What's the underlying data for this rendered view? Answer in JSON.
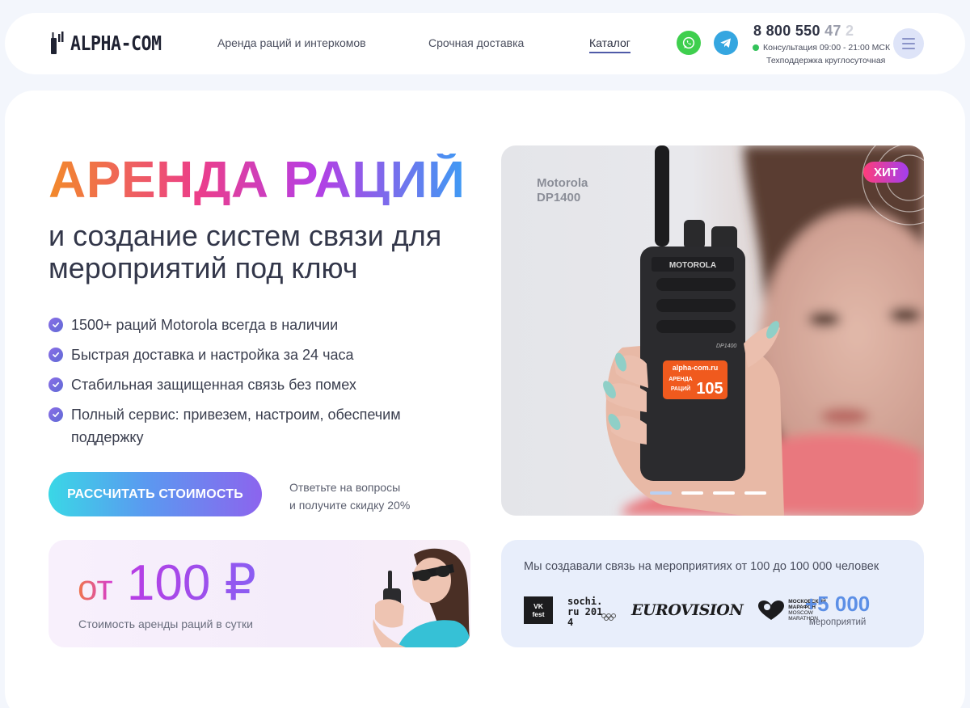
{
  "header": {
    "logo_text": "ALPHA-COM",
    "nav": {
      "rental": "Аренда раций и интеркомов",
      "delivery": "Срочная доставка",
      "catalog": "Каталог"
    },
    "phone": {
      "main": "8 800 550 ",
      "mid": "47",
      "tail": " 2"
    },
    "consult": "Консультация 09:00 - 21:00 МСК",
    "support": "Техподдержка круглосуточная"
  },
  "hero": {
    "title": "АРЕНДА РАЦИЙ",
    "subtitle": "и создание систем связи для мероприятий под ключ",
    "features": [
      "1500+ раций Motorola всегда в наличии",
      "Быстрая доставка и настройка за 24 часа",
      "Стабильная защищенная связь без помех",
      "Полный сервис: привезем, настроим, обеспечим поддержку"
    ],
    "cta_label": "РАССЧИТАТЬ СТОИМОСТЬ",
    "cta_note_line1": "Ответьте на вопросы",
    "cta_note_line2": "и получите скидку 20%"
  },
  "product": {
    "model_line1": "Motorola",
    "model_line2": "DP1400",
    "badge": "ХИТ",
    "radio_brand": "MOTOROLA",
    "radio_model": "DP1400",
    "sticker_site": "alpha-com.ru",
    "sticker_line1": "АРЕНДА",
    "sticker_line2": "РАЦИЙ",
    "sticker_number": "105"
  },
  "price": {
    "prefix": "от",
    "value": "100 ₽",
    "caption": "Стоимость аренды раций в сутки"
  },
  "events": {
    "title": "Мы создавали связь на мероприятиях от 100 до 100 000 человек",
    "logos": {
      "vk_fest": "VK fest",
      "sochi": "sochi.ru 2014",
      "eurovision": "EUROVISION",
      "marathon_l1": "МОСКОВСКИЙ",
      "marathon_l2": "МАРАФОН",
      "marathon_l3": "MOSCOW",
      "marathon_l4": "MARATHON"
    },
    "counter_value": "+5 000",
    "counter_label": "мероприятий"
  },
  "colors": {
    "accent_purple": "#8c64ee",
    "accent_blue": "#5c8fe6",
    "cta_cyan": "#3ad7e6",
    "whatsapp": "#3fcf4e",
    "telegram": "#35a6e0"
  },
  "icons": {
    "whatsapp": "whatsapp-icon",
    "telegram": "telegram-icon",
    "menu": "menu-icon",
    "check": "check-icon"
  }
}
